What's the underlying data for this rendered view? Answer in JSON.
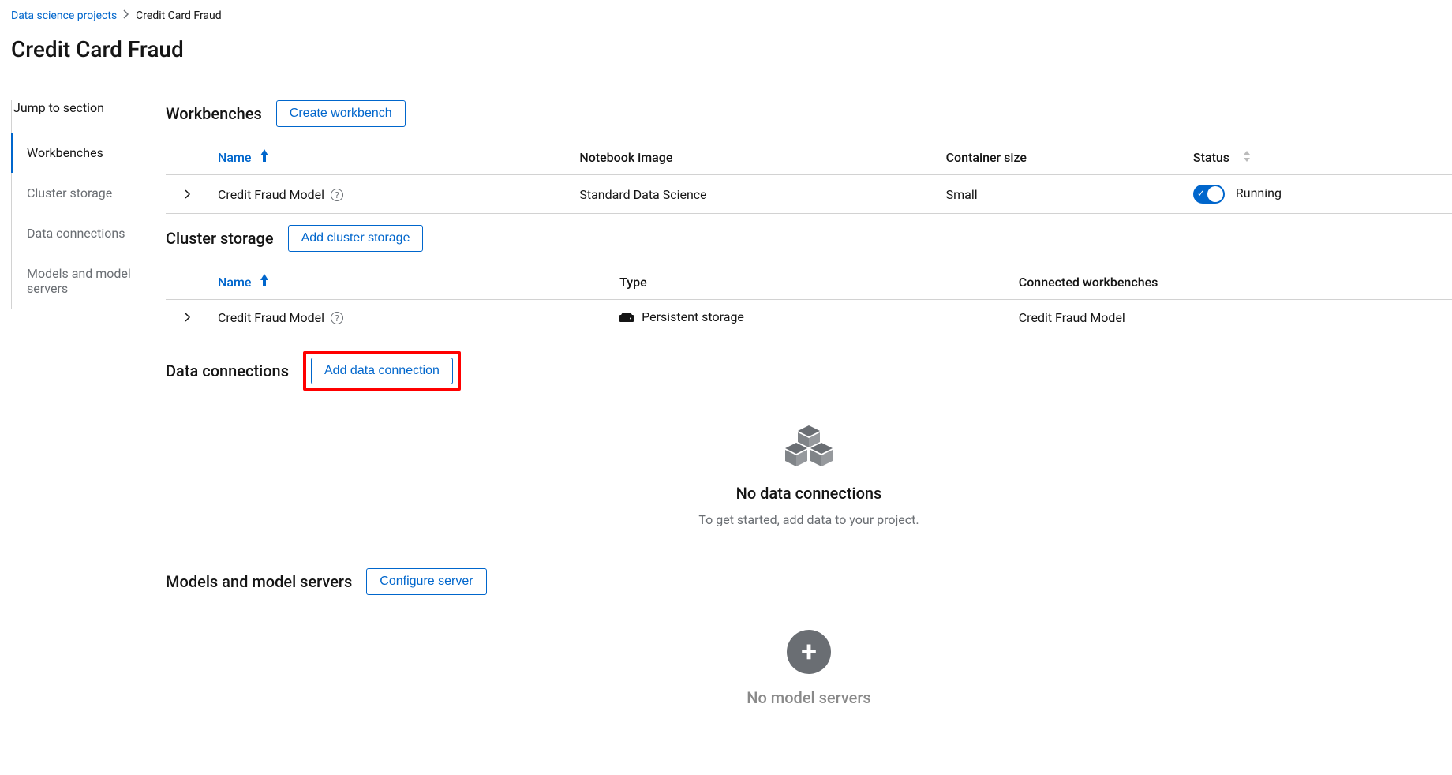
{
  "breadcrumb": {
    "root": "Data science projects",
    "current": "Credit Card Fraud"
  },
  "page_title": "Credit Card Fraud",
  "sidebar": {
    "title": "Jump to section",
    "items": [
      {
        "label": "Workbenches",
        "active": true
      },
      {
        "label": "Cluster storage",
        "active": false
      },
      {
        "label": "Data connections",
        "active": false
      },
      {
        "label": "Models and model servers",
        "active": false
      }
    ]
  },
  "workbenches": {
    "title": "Workbenches",
    "button": "Create workbench",
    "columns": {
      "name": "Name",
      "image": "Notebook image",
      "size": "Container size",
      "status": "Status"
    },
    "rows": [
      {
        "name": "Credit Fraud Model",
        "image": "Standard Data Science",
        "size": "Small",
        "status": "Running",
        "running": true
      }
    ]
  },
  "cluster_storage": {
    "title": "Cluster storage",
    "button": "Add cluster storage",
    "columns": {
      "name": "Name",
      "type": "Type",
      "connected": "Connected workbenches"
    },
    "rows": [
      {
        "name": "Credit Fraud Model",
        "type": "Persistent storage",
        "connected": "Credit Fraud Model"
      }
    ]
  },
  "data_connections": {
    "title": "Data connections",
    "button": "Add data connection",
    "empty_title": "No data connections",
    "empty_desc": "To get started, add data to your project."
  },
  "model_servers": {
    "title": "Models and model servers",
    "button": "Configure server",
    "empty_title": "No model servers"
  }
}
